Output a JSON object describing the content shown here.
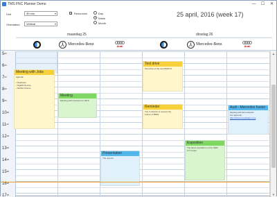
{
  "window": {
    "title": "TMS FNC Planner Demo",
    "min_glyph": "—",
    "max_glyph": "☐",
    "close_glyph": "✕"
  },
  "options": {
    "unit_label": "Unit",
    "unit_value": "30 min",
    "orientation_label": "Orientation",
    "orientation_value": "Vertical",
    "resources_label": "Resources",
    "resources_checked": true,
    "views": [
      "Day",
      "Week",
      "Month"
    ],
    "selected_view": "Week"
  },
  "header": {
    "date_title": "25 april, 2016 (week 17)"
  },
  "days": [
    "maandag 25",
    "dinsdag 26"
  ],
  "resources": [
    {
      "type": "bmw-logo"
    },
    {
      "type": "mercedes-logo",
      "label": "Mercedes-Benz"
    },
    {
      "type": "audi-logo",
      "label": "Audi"
    }
  ],
  "hours": [
    "5",
    "6",
    "7",
    "8",
    "9",
    "10",
    "11",
    "12",
    "13",
    "14",
    "15",
    "16",
    "17"
  ],
  "events": [
    {
      "id": "meeting-jobs",
      "title": "Meeting with Jobs",
      "color": "yellow",
      "lines": [
        "Agenda:",
        "",
        "• Notebook",
        "• Digital Finance",
        "• Mobile phones"
      ]
    },
    {
      "id": "meeting",
      "title": "Meeting",
      "color": "green",
      "lines": [
        "Meeting with investors for 2016"
      ]
    },
    {
      "id": "presentation",
      "title": "Presentation",
      "color": "blue",
      "lines": [
        "The new A1"
      ]
    },
    {
      "id": "test-drive",
      "title": "Test drive",
      "color": "yellow",
      "lines": [
        "Test drive of the new BMW i8"
      ]
    },
    {
      "id": "reminder",
      "title": "Reminder",
      "color": "yellow",
      "lines": [
        "Trip to Munich to present the",
        "Future of BMW"
      ]
    },
    {
      "id": "exposition",
      "title": "Exposition",
      "color": "green",
      "lines": [
        "The latest exposition on the NEW",
        "GT Coupé"
      ]
    },
    {
      "id": "audi-mercedes-fusion",
      "title": "Audi - Mercedes fusion",
      "color": "blue",
      "lines": [
        "Meeting with Ernst Reinitz",
        "For approval"
      ],
      "link": "http://www.tmssoftware.com"
    }
  ]
}
